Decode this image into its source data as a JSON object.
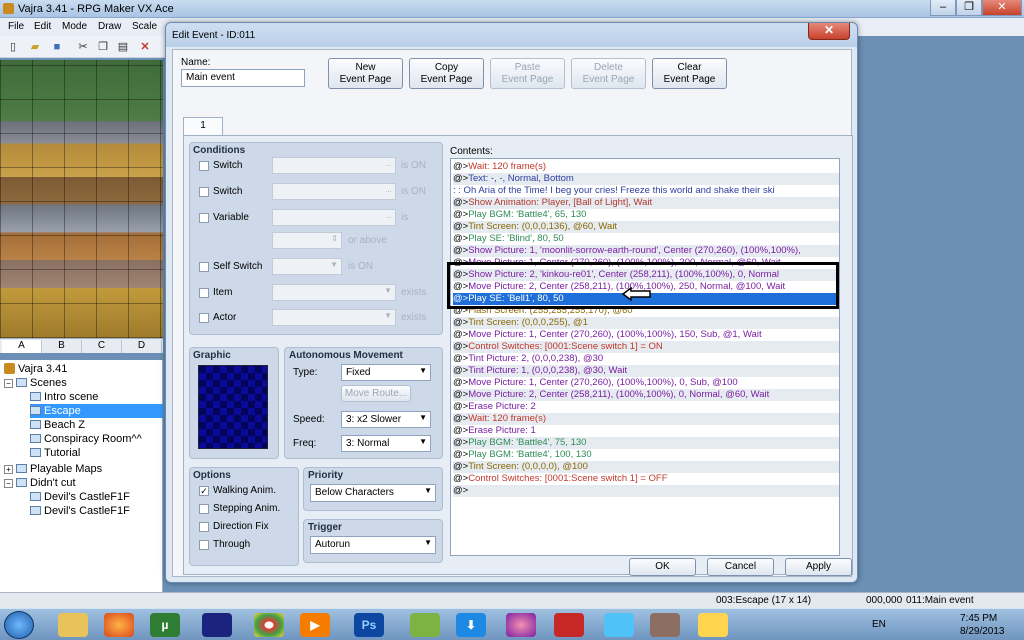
{
  "app": {
    "title": "Vajra 3.41 - RPG Maker VX Ace",
    "menu": [
      "File",
      "Edit",
      "Mode",
      "Draw",
      "Scale"
    ]
  },
  "tile_tabs": [
    "A",
    "B",
    "C",
    "D"
  ],
  "map_tree": {
    "root": "Vajra 3.41",
    "items": [
      "Scenes",
      "Intro scene",
      "Escape",
      "Beach Z",
      "Conspiracy Room^^",
      "Tutorial",
      "Playable Maps",
      "Didn't cut",
      "Devil's CastleF1F",
      "Devil's CastleF1F"
    ]
  },
  "dialog": {
    "title": "Edit Event - ID:011",
    "name_label": "Name:",
    "name_value": "Main event",
    "buttons": {
      "new": "New\nEvent Page",
      "copy": "Copy\nEvent Page",
      "paste": "Paste\nEvent Page",
      "delete": "Delete\nEvent Page",
      "clear": "Clear\nEvent Page"
    },
    "page_tab": "1",
    "conditions": {
      "title": "Conditions",
      "switch1": "Switch",
      "switch2": "Switch",
      "variable": "Variable",
      "self_switch": "Self Switch",
      "item": "Item",
      "actor": "Actor",
      "is_on1": "is ON",
      "is_on2": "is ON",
      "is": "is",
      "or_above": "or above",
      "is_on3": "is ON",
      "exists1": "exists",
      "exists2": "exists",
      "dots": "..."
    },
    "graphic_title": "Graphic",
    "autonomous": {
      "title": "Autonomous Movement",
      "type_label": "Type:",
      "type_value": "Fixed",
      "move_route": "Move Route...",
      "speed_label": "Speed:",
      "speed_value": "3: x2 Slower",
      "freq_label": "Freq:",
      "freq_value": "3: Normal"
    },
    "options": {
      "title": "Options",
      "walking": "Walking Anim.",
      "stepping": "Stepping Anim.",
      "direction": "Direction Fix",
      "through": "Through"
    },
    "priority": {
      "title": "Priority",
      "value": "Below Characters"
    },
    "trigger": {
      "title": "Trigger",
      "value": "Autorun"
    },
    "contents_label": "Contents:",
    "contents": [
      "@>Wait: 120 frame(s)",
      "@>Text: -, -, Normal, Bottom",
      " :      : Oh Aria of the Time! I beg your cries! Freeze this world and shake their ski",
      "@>Show Animation: Player, [Ball of Light], Wait",
      "@>Play BGM: 'Battle4', 65, 130",
      "@>Tint Screen: (0,0,0,136), @60, Wait",
      "@>Play SE: 'Blind', 80, 50",
      "@>Show Picture: 1, 'moonlit-sorrow-earth-round', Center (270,260), (100%,100%),",
      "@>Move Picture: 1, Center (270,260), (100%,100%), 200, Normal, @60, Wait",
      "@>Show Picture: 2, 'kinkou-re01', Center (258,211), (100%,100%), 0, Normal",
      "@>Move Picture: 2, Center (258,211), (100%,100%), 250, Normal, @100, Wait",
      "@>Play SE: 'Bell1', 80, 50",
      "@>Flash Screen: (255,255,255,170), @60",
      "@>Tint Screen: (0,0,0,255), @1",
      "@>Move Picture: 1, Center (270,260), (100%,100%), 150, Sub, @1, Wait",
      "@>Control Switches: [0001:Scene switch 1] = ON",
      "@>Tint Picture: 2, (0,0,0,238), @30",
      "@>Tint Picture: 1, (0,0,0,238), @30, Wait",
      "@>Move Picture: 1, Center (270,260), (100%,100%), 0, Sub, @100",
      "@>Move Picture: 2, Center (258,211), (100%,100%), 0, Normal, @60, Wait",
      "@>Erase Picture: 2",
      "@>Wait: 120 frame(s)",
      "@>Erase Picture: 1",
      "@>Play BGM: 'Battle4', 75, 130",
      "@>Play BGM: 'Battle4', 100, 130",
      "@>Tint Screen: (0,0,0,0), @100",
      "@>Control Switches: [0001:Scene switch 1] = OFF",
      "@>"
    ],
    "ok": "OK",
    "cancel": "Cancel",
    "apply": "Apply"
  },
  "status": {
    "left": "003:Escape (17 x 14)",
    "coords": "000,000",
    "event": "011:Main event"
  },
  "tray": {
    "lang": "EN",
    "time": "7:45 PM",
    "date": "8/29/2013"
  },
  "colors": {
    "wait": "#c0392b",
    "text": "#2c3e9e",
    "anim": "#b03a2e",
    "audio": "#2e8b57",
    "screen": "#8a6a00",
    "picture": "#7a1fa2",
    "switch": "#c0392b",
    "plain": "#000000"
  }
}
